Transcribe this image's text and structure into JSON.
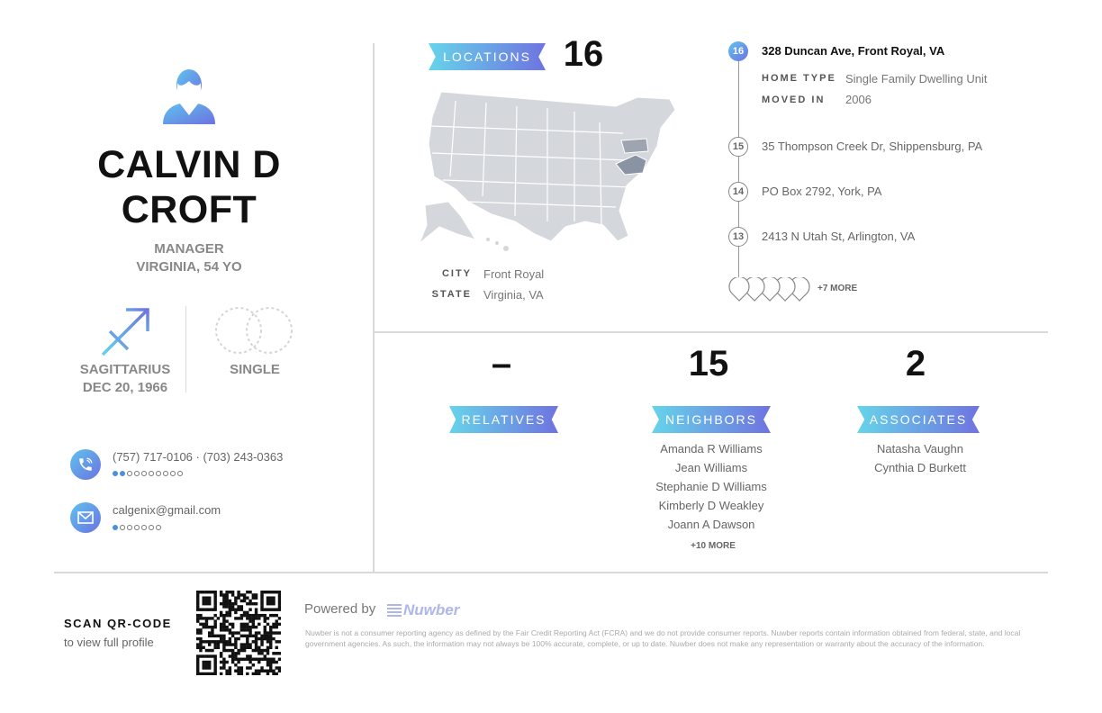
{
  "profile": {
    "first_line": "CALVIN D",
    "second_line": "CROFT",
    "occupation": "MANAGER",
    "location_age": "VIRGINIA, 54 YO",
    "zodiac": "SAGITTARIUS",
    "birthdate": "DEC 20, 1966",
    "marital_status": "SINGLE",
    "phones": "(757) 717-0106 · (703) 243-0363",
    "phone_dots": {
      "filled": 2,
      "total": 10
    },
    "email": "calgenix@gmail.com",
    "email_dots": {
      "filled": 1,
      "total": 7
    }
  },
  "locations": {
    "label": "LOCATIONS",
    "count": "16",
    "city_key": "CITY",
    "city": "Front Royal",
    "state_key": "STATE",
    "state": "Virginia, VA"
  },
  "timeline": {
    "current": {
      "number": "16",
      "address": "328 Duncan Ave, Front Royal, VA",
      "home_type_key": "HOME TYPE",
      "home_type": "Single Family Dwelling Unit",
      "moved_in_key": "MOVED IN",
      "moved_in": "2006"
    },
    "previous": [
      {
        "number": "15",
        "address": "35 Thompson Creek Dr, Shippensburg, PA"
      },
      {
        "number": "14",
        "address": "PO Box 2792, York, PA"
      },
      {
        "number": "13",
        "address": "2413 N Utah St, Arlington, VA"
      }
    ],
    "more": "+7 MORE"
  },
  "relatives": {
    "count": "–",
    "label": "RELATIVES"
  },
  "neighbors": {
    "count": "15",
    "label": "NEIGHBORS",
    "names": [
      "Amanda R Williams",
      "Jean Williams",
      "Stephanie D Williams",
      "Kimberly D Weakley",
      "Joann A Dawson"
    ],
    "more": "+10 MORE"
  },
  "associates": {
    "count": "2",
    "label": "ASSOCIATES",
    "names": [
      "Natasha Vaughn",
      "Cynthia D Burkett"
    ]
  },
  "footer": {
    "scan_title": "SCAN QR-CODE",
    "scan_sub": "to view full profile",
    "powered_by": "Powered by",
    "brand": "Nuwber",
    "disclaimer": "Nuwber is not a consumer reporting agency as defined by the Fair Credit Reporting Act (FCRA) and we do not provide consumer reports. Nuwber reports contain information obtained from federal, state, and local government agencies. As such, the information may not always be 100% accurate, complete, or up to date. Nuwber does not make any representation or warranty about the accuracy of the information."
  },
  "colors": {
    "accent_start": "#66d4ea",
    "accent_end": "#6f73e0",
    "highlight_state": "#8a93a3"
  }
}
